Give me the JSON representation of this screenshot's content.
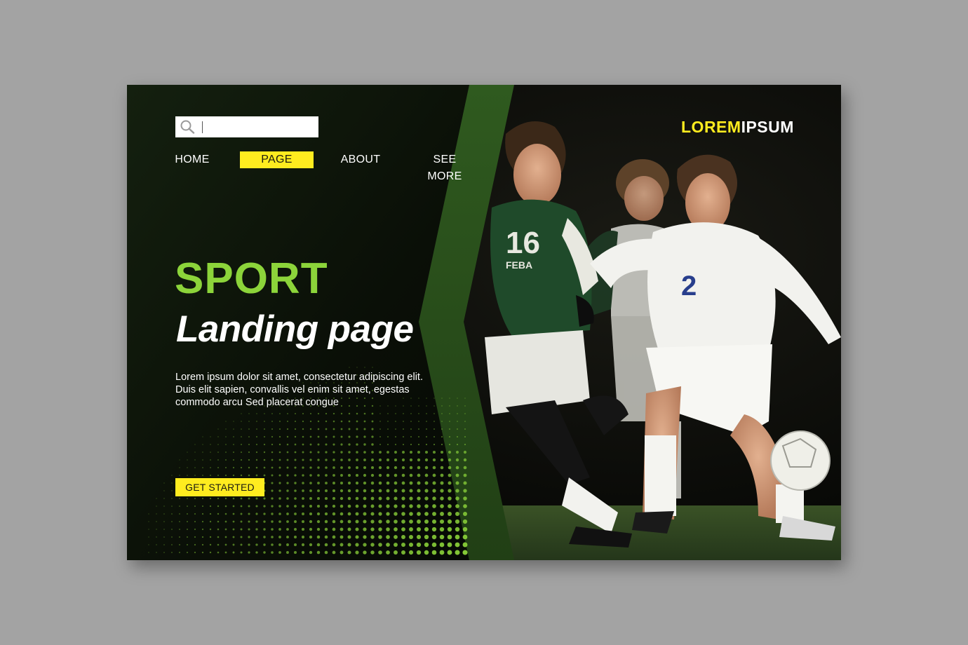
{
  "brand": {
    "part1": "LOREM",
    "part2": "IPSUM"
  },
  "search": {
    "value": "",
    "icon": "search-icon"
  },
  "nav": {
    "items": [
      {
        "label": "HOME",
        "active": false
      },
      {
        "label": "PAGE",
        "active": true
      },
      {
        "label": "ABOUT",
        "active": false
      },
      {
        "label": "SEE MORE",
        "active": false
      }
    ]
  },
  "hero": {
    "title": "SPORT",
    "subtitle": "Landing page",
    "description": "Lorem ipsum dolor sit amet, consectetur adipiscing elit. Duis elit sapien, convallis vel enim sit amet, egestas commodo arcu Sed placerat congue",
    "cta_label": "GET STARTED",
    "photo": {
      "jersey_green": "16",
      "jersey_white": "2"
    }
  },
  "colors": {
    "accent_yellow": "#ffec1f",
    "accent_green": "#8cd43a",
    "panel_dark": "#0c1209",
    "stripe_green": "#2f5a1f",
    "page_background": "#a3a3a3"
  }
}
